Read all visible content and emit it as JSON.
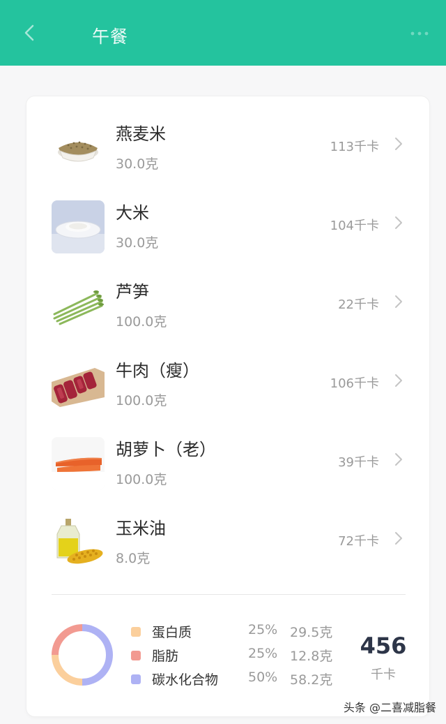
{
  "header": {
    "title": "午餐",
    "background_color": "#24c39e"
  },
  "foods": [
    {
      "name": "燕麦米",
      "amount": "30.0克",
      "calories": "113千卡",
      "icon": "oat-rice-bowl-image"
    },
    {
      "name": "大米",
      "amount": "30.0克",
      "calories": "104千卡",
      "icon": "rice-plate-image"
    },
    {
      "name": "芦笋",
      "amount": "100.0克",
      "calories": "22千卡",
      "icon": "asparagus-image"
    },
    {
      "name": "牛肉（瘦）",
      "amount": "100.0克",
      "calories": "106千卡",
      "icon": "lean-beef-image"
    },
    {
      "name": "胡萝卜（老）",
      "amount": "100.0克",
      "calories": "39千卡",
      "icon": "carrot-image"
    },
    {
      "name": "玉米油",
      "amount": "8.0克",
      "calories": "72千卡",
      "icon": "corn-oil-image"
    }
  ],
  "nutrition": {
    "items": [
      {
        "name": "蛋白质",
        "percent": "25%",
        "grams": "29.5克",
        "color": "#fbcf9c",
        "share": 25
      },
      {
        "name": "脂肪",
        "percent": "25%",
        "grams": "12.8克",
        "color": "#f29a91",
        "share": 25
      },
      {
        "name": "碳水化合物",
        "percent": "50%",
        "grams": "58.2克",
        "color": "#aeb2f4",
        "share": 50
      }
    ],
    "total_value": "456",
    "total_unit": "千卡"
  },
  "watermark": "头条 @二喜减脂餐"
}
